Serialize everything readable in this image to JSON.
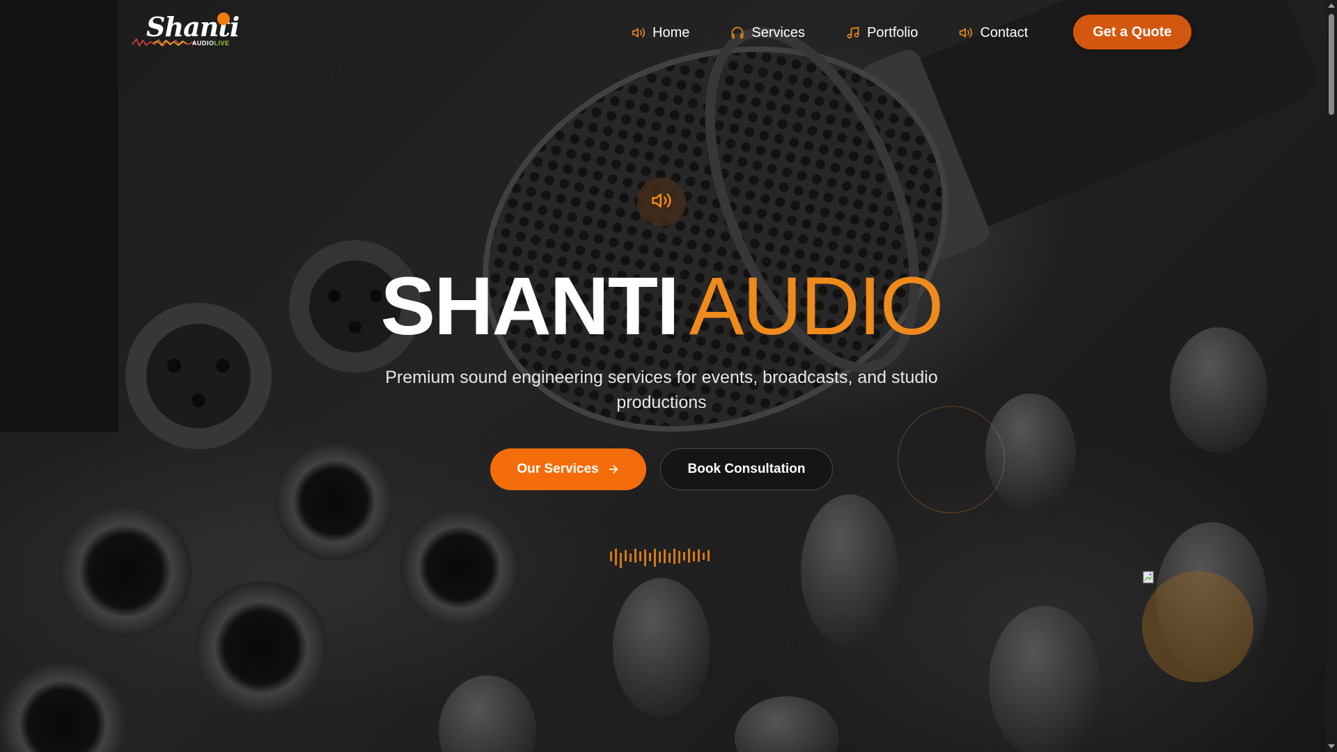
{
  "brand": {
    "logo_script": "Shanti",
    "logo_sub_audio": "AUDIO",
    "logo_sub_live": "LIVE"
  },
  "nav": {
    "items": [
      {
        "label": "Home",
        "icon": "speaker-icon"
      },
      {
        "label": "Services",
        "icon": "headphones-icon"
      },
      {
        "label": "Portfolio",
        "icon": "music-note-icon"
      },
      {
        "label": "Contact",
        "icon": "speaker-icon"
      }
    ],
    "cta_label": "Get a Quote"
  },
  "hero": {
    "title_part1": "SHANTI",
    "title_part2": "AUDIO",
    "subtitle": "Premium sound engineering services for events, broadcasts, and studio productions",
    "primary_button": "Our Services",
    "secondary_button": "Book Consultation"
  },
  "colors": {
    "accent": "#f08a1c",
    "primary_button": "#f56d0a",
    "quote_button": "#d4570f",
    "text": "#ffffff"
  }
}
